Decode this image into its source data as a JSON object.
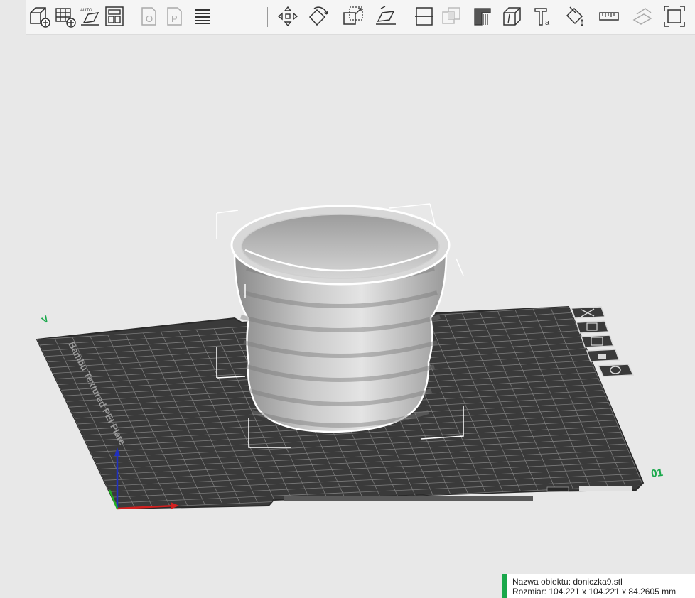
{
  "toolbar": {
    "icons": [
      "add-object-icon",
      "add-plate-icon",
      "auto-orient-icon",
      "arrange-icon",
      "split-objects-icon",
      "split-parts-icon",
      "variable-layer-height-icon",
      "move-icon",
      "rotate-icon",
      "scale-icon",
      "lay-on-face-icon",
      "cut-icon",
      "boolean-icon",
      "support-painting-icon",
      "seam-painting-icon",
      "text-icon",
      "color-painting-icon",
      "measure-icon",
      "assembly-icon",
      "fit-view-icon"
    ]
  },
  "plate": {
    "name": "Bambu Textured PEI Plate",
    "number": "01",
    "corner_label": "V"
  },
  "object_info": {
    "name_line": "Nazwa obiektu: doniczka9.stl",
    "size_line": "Rozmiar: 104.221 x 104.221 x 84.2605 mm"
  },
  "colors": {
    "background": "#e8e8e8",
    "plate": "#3a3a3a",
    "grid": "#7a7a7a",
    "accent_green": "#1aa84b",
    "axis_x": "#d22020",
    "axis_y": "#20b020",
    "axis_z": "#2030c0"
  }
}
